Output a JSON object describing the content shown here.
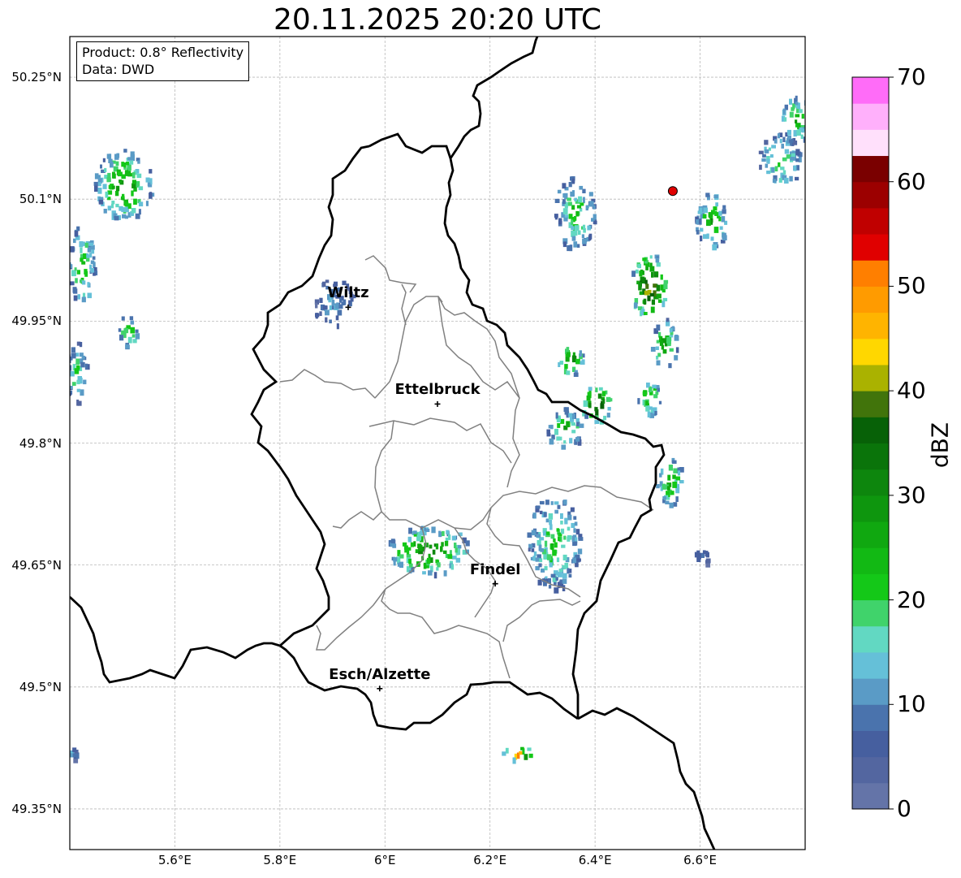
{
  "title": "20.11.2025 20:20 UTC",
  "info": {
    "product": "Product: 0.8° Reflectivity",
    "data": "Data: DWD"
  },
  "axes": {
    "x_ticks": [
      "5.6°E",
      "5.8°E",
      "6°E",
      "6.2°E",
      "6.4°E",
      "6.6°E"
    ],
    "y_ticks": [
      "50.25°N",
      "50.1°N",
      "49.95°N",
      "49.8°N",
      "49.65°N",
      "49.5°N",
      "49.35°N"
    ],
    "lon_range": [
      5.4,
      6.8
    ],
    "lat_range": [
      49.3,
      50.3
    ],
    "grid": true
  },
  "cities": [
    {
      "name": "Wiltz",
      "lon": 5.93,
      "lat": 49.967
    },
    {
      "name": "Ettelbruck",
      "lon": 6.1,
      "lat": 49.848
    },
    {
      "name": "Findel",
      "lon": 6.21,
      "lat": 49.627
    },
    {
      "name": "Esch/Alzette",
      "lon": 5.99,
      "lat": 49.498
    }
  ],
  "radar_site": {
    "lon": 6.548,
    "lat": 50.11
  },
  "colorbar": {
    "label": "dBZ",
    "ticks": [
      "0",
      "10",
      "20",
      "30",
      "40",
      "50",
      "60",
      "70"
    ],
    "min": 0,
    "max": 70,
    "step": 2.5,
    "colors": [
      "#6474a8",
      "#5366a0",
      "#465f9f",
      "#4a73ad",
      "#5a9bc6",
      "#65c0d8",
      "#62d8c2",
      "#40d36b",
      "#14c818",
      "#12b914",
      "#10a810",
      "#0e960e",
      "#0d860d",
      "#0a740a",
      "#076107",
      "#41740b",
      "#aab200",
      "#ffd700",
      "#ffb400",
      "#ff9b00",
      "#ff7f00",
      "#e00000",
      "#c00000",
      "#9c0000",
      "#7a0000",
      "#ffe0fb",
      "#ffb0fb",
      "#ff6cf8",
      "#ec3ce9"
    ]
  },
  "echo_areas": [
    {
      "lon": 5.5,
      "lat": 50.12,
      "rlon": 0.055,
      "rlat": 0.045,
      "level": 12
    },
    {
      "lon": 5.42,
      "lat": 50.02,
      "rlon": 0.025,
      "rlat": 0.05,
      "level": 10
    },
    {
      "lon": 5.41,
      "lat": 49.89,
      "rlon": 0.02,
      "rlat": 0.04,
      "level": 8
    },
    {
      "lon": 5.51,
      "lat": 49.94,
      "rlon": 0.02,
      "rlat": 0.02,
      "level": 10
    },
    {
      "lon": 5.9,
      "lat": 49.975,
      "rlon": 0.04,
      "rlat": 0.03,
      "level": 4
    },
    {
      "lon": 6.36,
      "lat": 50.085,
      "rlon": 0.04,
      "rlat": 0.045,
      "level": 9
    },
    {
      "lon": 6.5,
      "lat": 49.995,
      "rlon": 0.035,
      "rlat": 0.04,
      "level": 18
    },
    {
      "lon": 6.53,
      "lat": 49.925,
      "rlon": 0.025,
      "rlat": 0.03,
      "level": 11
    },
    {
      "lon": 6.62,
      "lat": 50.075,
      "rlon": 0.03,
      "rlat": 0.035,
      "level": 11
    },
    {
      "lon": 6.35,
      "lat": 49.905,
      "rlon": 0.025,
      "rlat": 0.02,
      "level": 14
    },
    {
      "lon": 6.4,
      "lat": 49.85,
      "rlon": 0.028,
      "rlat": 0.022,
      "level": 18
    },
    {
      "lon": 6.34,
      "lat": 49.82,
      "rlon": 0.035,
      "rlat": 0.025,
      "level": 11
    },
    {
      "lon": 6.5,
      "lat": 49.86,
      "rlon": 0.025,
      "rlat": 0.025,
      "level": 11
    },
    {
      "lon": 6.54,
      "lat": 49.755,
      "rlon": 0.025,
      "rlat": 0.03,
      "level": 11
    },
    {
      "lon": 6.32,
      "lat": 49.68,
      "rlon": 0.05,
      "rlat": 0.06,
      "level": 9
    },
    {
      "lon": 6.08,
      "lat": 49.67,
      "rlon": 0.08,
      "rlat": 0.03,
      "level": 13
    },
    {
      "lon": 6.25,
      "lat": 49.42,
      "rlon": 0.03,
      "rlat": 0.008,
      "level": 20
    },
    {
      "lon": 6.75,
      "lat": 50.15,
      "rlon": 0.04,
      "rlat": 0.035,
      "level": 9
    },
    {
      "lon": 6.78,
      "lat": 50.2,
      "rlon": 0.03,
      "rlat": 0.03,
      "level": 10
    },
    {
      "lon": 6.6,
      "lat": 49.66,
      "rlon": 0.015,
      "rlat": 0.01,
      "level": 5
    },
    {
      "lon": 5.4,
      "lat": 49.42,
      "rlon": 0.012,
      "rlat": 0.01,
      "level": 5
    }
  ]
}
